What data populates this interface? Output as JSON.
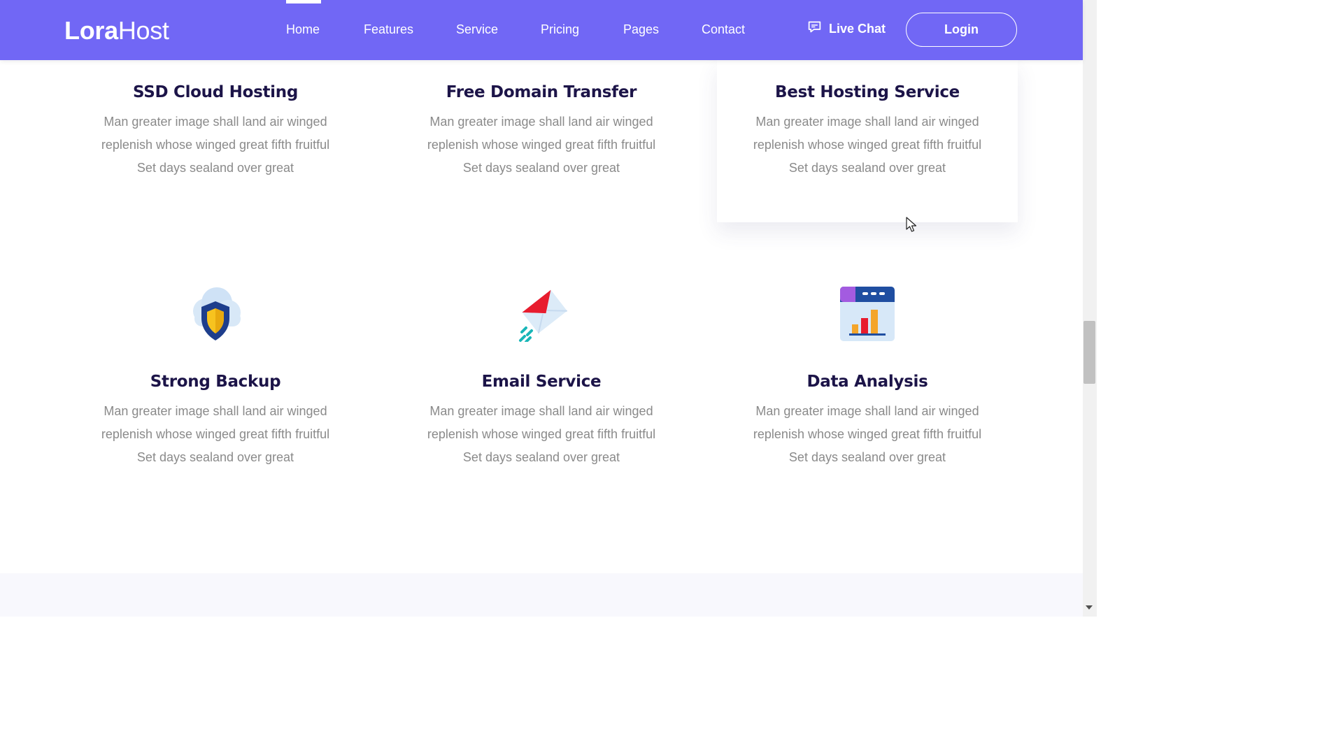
{
  "header": {
    "logo_bold": "Lora",
    "logo_light": "Host",
    "nav": [
      "Home",
      "Features",
      "Service",
      "Pricing",
      "Pages",
      "Contact"
    ],
    "active_nav": "Home",
    "live_chat_label": "Live Chat",
    "live_chat_icon": "chat-bubble-icon",
    "login_label": "Login",
    "background_color": "#7167f5"
  },
  "services": [
    {
      "title": "SSD Cloud Hosting",
      "desc": "Man greater image shall land air winged replenish whose winged great fifth fruitful Set days sealand over great"
    },
    {
      "title": "Free Domain Transfer",
      "desc": "Man greater image shall land air winged replenish whose winged great fifth fruitful Set days sealand over great"
    },
    {
      "title": "Best Hosting Service",
      "desc": "Man greater image shall land air winged replenish whose winged great fifth fruitful Set days sealand over great"
    },
    {
      "title": "Strong Backup",
      "icon": "cloud-shield-icon",
      "desc": "Man greater image shall land air winged replenish whose winged great fifth fruitful Set days sealand over great"
    },
    {
      "title": "Email Service",
      "icon": "flying-envelope-icon",
      "desc": "Man greater image shall land air winged replenish whose winged great fifth fruitful Set days sealand over great"
    },
    {
      "title": "Data Analysis",
      "icon": "browser-chart-icon",
      "desc": "Man greater image shall land air winged replenish whose winged great fifth fruitful Set days sealand over great"
    }
  ],
  "colors": {
    "title": "#1c1448",
    "description": "#8a8a8a",
    "accent": "#7167f5"
  }
}
